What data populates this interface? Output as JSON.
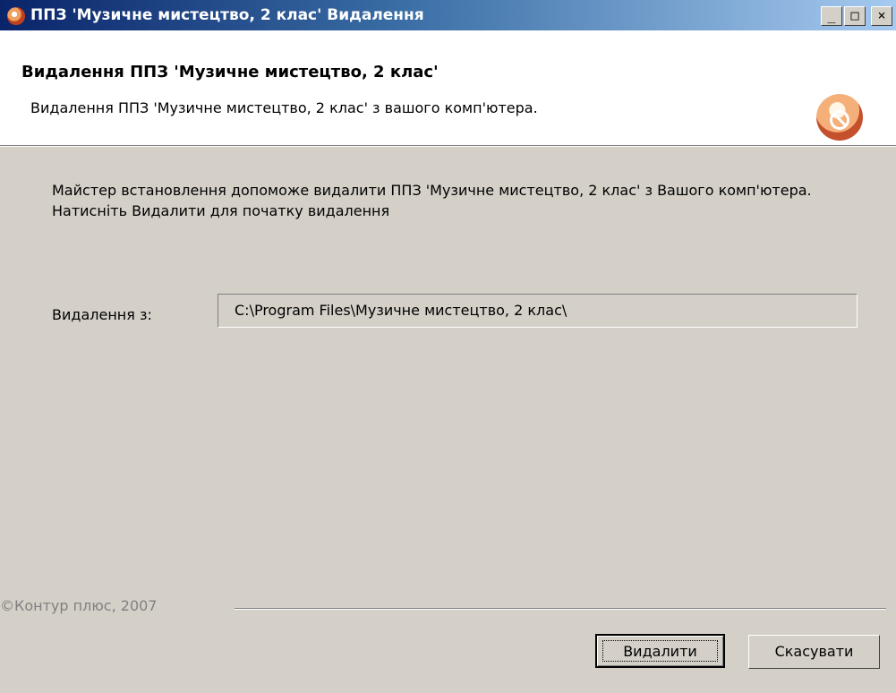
{
  "window": {
    "title": "ППЗ 'Музичне мистецтво, 2 клас' Видалення",
    "app_icon": "cd-app-icon",
    "controls": {
      "minimize": "_",
      "maximize": "□",
      "close": "×"
    }
  },
  "header": {
    "title": "Видалення ППЗ 'Музичне мистецтво, 2 клас'",
    "subtitle": "Видалення ППЗ 'Музичне мистецтво, 2 клас' з вашого комп'ютера.",
    "icon": "uninstall-disc-icon"
  },
  "body": {
    "description": "Майстер встановлення допоможе видалити ППЗ 'Музичне мистецтво, 2 клас' з Вашого комп'ютера. Натисніть Видалити для початку видалення",
    "path_label": "Видалення з:",
    "path_value": "C:\\Program Files\\Музичне мистецтво, 2 клас\\"
  },
  "footer": {
    "copyright": "©Контур плюс, 2007",
    "remove_label": "Видалити",
    "cancel_label": "Скасувати"
  },
  "colors": {
    "titlebar_start": "#0a246a",
    "titlebar_end": "#a6caf0",
    "dialog_bg": "#d4d0c8",
    "header_bg": "#ffffff"
  }
}
